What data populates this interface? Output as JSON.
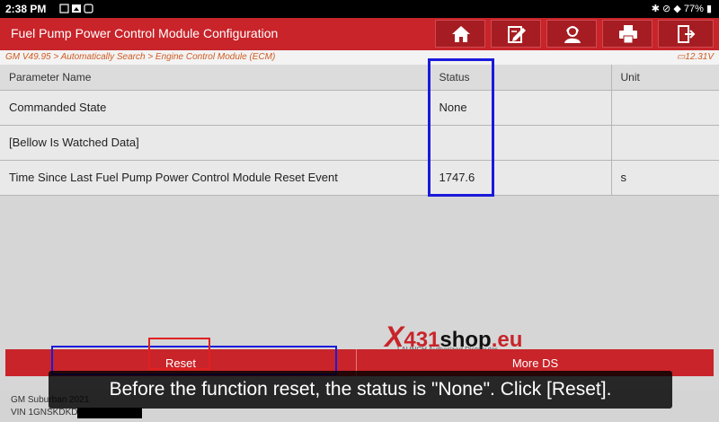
{
  "status_bar": {
    "time": "2:38 PM",
    "battery": "77%"
  },
  "header": {
    "title": "Fuel Pump Power Control Module Configuration"
  },
  "toolbar": {
    "icons": [
      "home-icon",
      "edit-report-icon",
      "user-support-icon",
      "print-icon",
      "exit-icon"
    ]
  },
  "breadcrumb": {
    "path": "GM V49.95 > Automatically Search > Engine Control Module (ECM)",
    "voltage": "12.31V"
  },
  "table": {
    "columns": [
      "Parameter Name",
      "Status",
      "Unit"
    ],
    "rows": [
      {
        "name": "Commanded State",
        "status": "None",
        "unit": ""
      },
      {
        "name": "[Bellow Is Watched Data]",
        "status": "",
        "unit": ""
      },
      {
        "name": "Time Since Last Fuel Pump Power Control Module Reset Event",
        "status": "1747.6",
        "unit": "s"
      }
    ]
  },
  "buttons": {
    "reset": "Reset",
    "more_ds": "More DS"
  },
  "vehicle": {
    "model": "GM Suburban 2021",
    "vin": "VIN 1GNSKDKD9MR"
  },
  "caption": "Before the function reset, the status is \"None\". Click [Reset].",
  "watermark": {
    "brand_x": "X",
    "brand_num": "431",
    "brand_shop": "shop",
    "brand_tld": ".eu",
    "tagline": "LAUNCH Authorized Distributor"
  },
  "colors": {
    "accent": "#c8242a",
    "highlight_blue": "#1a1adb",
    "highlight_red": "#e02020"
  }
}
